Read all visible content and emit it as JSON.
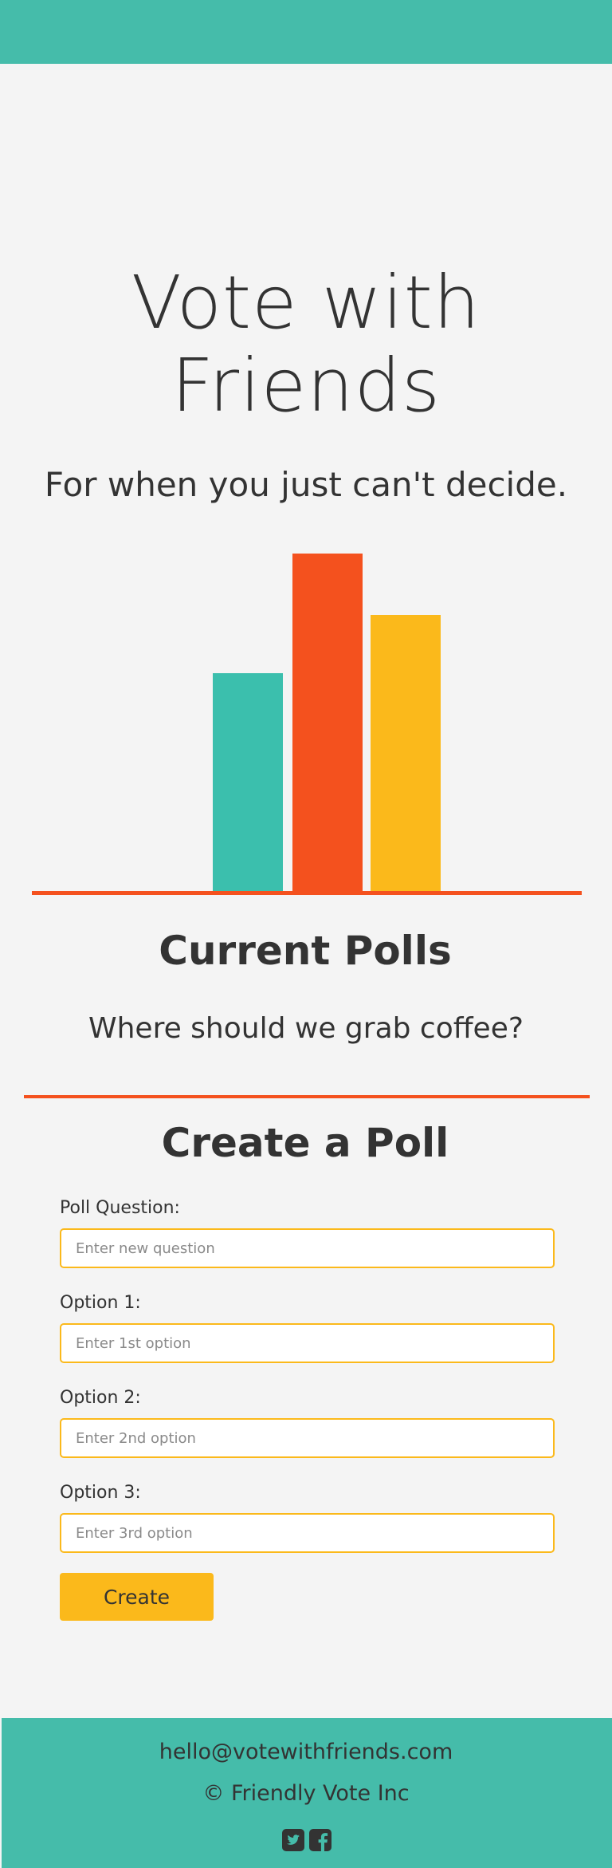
{
  "colors": {
    "teal": "#3bbfad",
    "orange": "#f4511e",
    "yellow": "#fbb91b",
    "header_bg": "#45bcaa",
    "text": "#333333"
  },
  "hero": {
    "title_line1": "Vote with",
    "title_line2": "Friends",
    "subtitle": "For when you just can't decide."
  },
  "hero_graphic": {
    "bars": [
      {
        "relative_height": 0.65,
        "color": "#3bbfad"
      },
      {
        "relative_height": 1.0,
        "color": "#f4511e"
      },
      {
        "relative_height": 0.82,
        "color": "#fbb91b"
      }
    ],
    "baseline_color": "#f4511e"
  },
  "current_polls": {
    "title": "Current Polls",
    "items": [
      "Where should we grab coffee?"
    ]
  },
  "create_poll": {
    "title": "Create a Poll",
    "question_label": "Poll Question:",
    "question_placeholder": "Enter new question",
    "question_value": "",
    "options": [
      {
        "label": "Option 1:",
        "placeholder": "Enter 1st option",
        "value": ""
      },
      {
        "label": "Option 2:",
        "placeholder": "Enter 2nd option",
        "value": ""
      },
      {
        "label": "Option 3:",
        "placeholder": "Enter 3rd option",
        "value": ""
      }
    ],
    "submit_label": "Create"
  },
  "footer": {
    "email": "hello@votewithfriends.com",
    "copyright": "© Friendly Vote Inc",
    "social_icons": [
      "twitter-icon",
      "facebook-icon"
    ]
  }
}
